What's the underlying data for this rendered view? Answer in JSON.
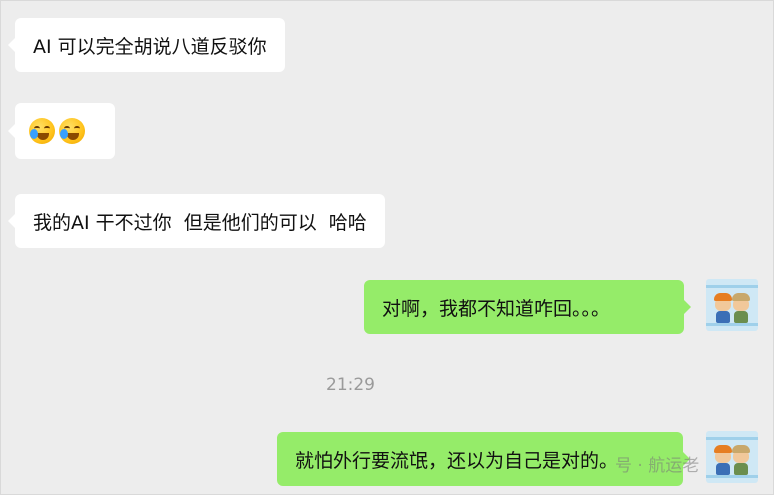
{
  "messages": [
    {
      "side": "left",
      "text": "AI 可以完全胡说八道反驳你"
    },
    {
      "side": "left",
      "emojis": [
        "laugh-cry-emoji",
        "laugh-cry-emoji"
      ]
    },
    {
      "side": "left",
      "text": "我的AI 干不过你  但是他们的可以  哈哈"
    },
    {
      "side": "right",
      "text": "对啊，我都不知道咋回。。。"
    },
    {
      "side": "right",
      "text": "就怕外行要流氓，还以为自己是对的。"
    }
  ],
  "timestamp": "21:29",
  "watermark": "号 · 航运老",
  "colors": {
    "background": "#ededed",
    "left_bubble": "#ffffff",
    "right_bubble": "#95ec69",
    "timestamp": "#9a9a9a"
  },
  "icons": {
    "self_avatar": "cartoon-couple-avatar"
  }
}
